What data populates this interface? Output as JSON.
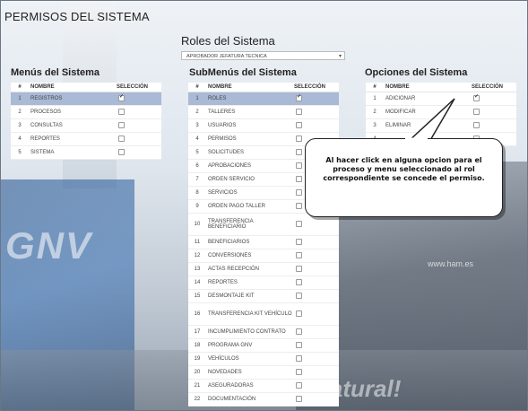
{
  "page": {
    "title": "PERMISOS DEL SISTEMA"
  },
  "roles": {
    "title": "Roles del Sistema",
    "selected": "APROBADOR JEFATURA TECNICA"
  },
  "menus": {
    "title": "Menús del Sistema",
    "headers": {
      "num": "#",
      "name": "NOMBRE",
      "check": "SELECCIÓN"
    },
    "rows": [
      {
        "n": "1",
        "name": "REGISTROS",
        "checked": true,
        "selected": true
      },
      {
        "n": "2",
        "name": "PROCESOS",
        "checked": false
      },
      {
        "n": "3",
        "name": "CONSULTAS",
        "checked": false
      },
      {
        "n": "4",
        "name": "REPORTES",
        "checked": false
      },
      {
        "n": "5",
        "name": "SISTEMA",
        "checked": false
      }
    ]
  },
  "submenus": {
    "title": "SubMenús del Sistema",
    "headers": {
      "num": "#",
      "name": "NOMBRE",
      "check": "SELECCIÓN"
    },
    "rows": [
      {
        "n": "1",
        "name": "ROLES",
        "checked": true,
        "selected": true
      },
      {
        "n": "2",
        "name": "TALLERES",
        "checked": false
      },
      {
        "n": "3",
        "name": "USUARIOS",
        "checked": false
      },
      {
        "n": "4",
        "name": "PERMISOS",
        "checked": false
      },
      {
        "n": "5",
        "name": "SOLICITUDES",
        "checked": false
      },
      {
        "n": "6",
        "name": "APROBACIONES",
        "checked": false
      },
      {
        "n": "7",
        "name": "ORDEN SERVICIO",
        "checked": false
      },
      {
        "n": "8",
        "name": "SERVICIOS",
        "checked": false
      },
      {
        "n": "9",
        "name": "ORDEN PAGO TALLER",
        "checked": false
      },
      {
        "n": "10",
        "name": "TRANSFERENCIA BENEFICIARIO",
        "checked": false,
        "tall": true
      },
      {
        "n": "11",
        "name": "BENEFICIARIOS",
        "checked": false
      },
      {
        "n": "12",
        "name": "CONVERSIONES",
        "checked": false
      },
      {
        "n": "13",
        "name": "ACTAS RECEPCIÓN",
        "checked": false
      },
      {
        "n": "14",
        "name": "REPORTES",
        "checked": false
      },
      {
        "n": "15",
        "name": "DESMONTAJE KIT",
        "checked": false
      },
      {
        "n": "16",
        "name": "TRANSFERENCIA KIT VEHÍCULO",
        "checked": false,
        "tall": true
      },
      {
        "n": "17",
        "name": "INCUMPLIMIENTO CONTRATO",
        "checked": false
      },
      {
        "n": "18",
        "name": "PROGRAMA GNV",
        "checked": false
      },
      {
        "n": "19",
        "name": "VEHÍCULOS",
        "checked": false
      },
      {
        "n": "20",
        "name": "NOVEDADES",
        "checked": false
      },
      {
        "n": "21",
        "name": "ASEGURADORAS",
        "checked": false
      },
      {
        "n": "22",
        "name": "DOCUMENTACIÓN",
        "checked": false
      }
    ]
  },
  "options": {
    "title": "Opciones del Sistema",
    "headers": {
      "num": "#",
      "name": "NOMBRE",
      "check": "SELECCIÓN"
    },
    "rows": [
      {
        "n": "1",
        "name": "ADICIONAR",
        "checked": true
      },
      {
        "n": "2",
        "name": "MODIFICAR",
        "checked": false
      },
      {
        "n": "3",
        "name": "ELIMINAR",
        "checked": false
      },
      {
        "n": "4",
        "name": "",
        "checked": false
      }
    ]
  },
  "callout": {
    "text": "Al hacer click en alguna opcion para el proceso y menu seleccionado al rol correspondiente se concede el permiso."
  },
  "background": {
    "brand_text": "GNV",
    "slogan": "gas natural!",
    "url": "www.ham.es"
  },
  "colors": {
    "selected_row": "#a9b9d6",
    "panel_bg": "#ffffff"
  }
}
